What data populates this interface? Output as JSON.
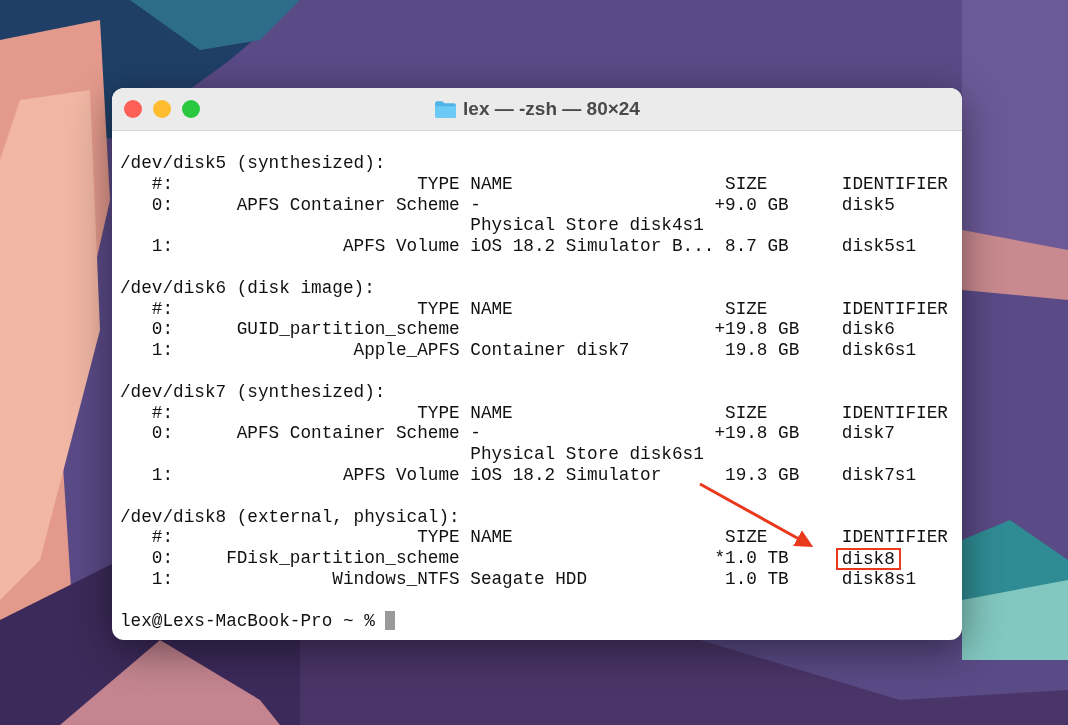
{
  "window": {
    "title": "lex — -zsh — 80×24"
  },
  "sections": [
    {
      "header": "/dev/disk5 (synthesized):",
      "lines": [
        {
          "text": "   #:                       TYPE NAME                    SIZE       IDENTIFIER"
        },
        {
          "text": "   0:      APFS Container Scheme -                      +9.0 GB     disk5"
        },
        {
          "text": "                                 Physical Store disk4s1"
        },
        {
          "text": "   1:                APFS Volume iOS 18.2 Simulator B... 8.7 GB     disk5s1"
        }
      ]
    },
    {
      "header": "/dev/disk6 (disk image):",
      "lines": [
        {
          "text": "   #:                       TYPE NAME                    SIZE       IDENTIFIER"
        },
        {
          "text": "   0:      GUID_partition_scheme                        +19.8 GB    disk6"
        },
        {
          "text": "   1:                 Apple_APFS Container disk7         19.8 GB    disk6s1"
        }
      ]
    },
    {
      "header": "/dev/disk7 (synthesized):",
      "lines": [
        {
          "text": "   #:                       TYPE NAME                    SIZE       IDENTIFIER"
        },
        {
          "text": "   0:      APFS Container Scheme -                      +19.8 GB    disk7"
        },
        {
          "text": "                                 Physical Store disk6s1"
        },
        {
          "text": "   1:                APFS Volume iOS 18.2 Simulator      19.3 GB    disk7s1"
        }
      ]
    },
    {
      "header": "/dev/disk8 (external, physical):",
      "lines": [
        {
          "text": "   #:                       TYPE NAME                    SIZE       IDENTIFIER"
        },
        {
          "text": "   0:     FDisk_partition_scheme                        *1.0 TB",
          "highlight": "disk8"
        },
        {
          "text": "   1:               Windows_NTFS Seagate HDD             1.0 TB     disk8s1"
        }
      ]
    }
  ],
  "prompt": "lex@Lexs-MacBook-Pro ~ %"
}
